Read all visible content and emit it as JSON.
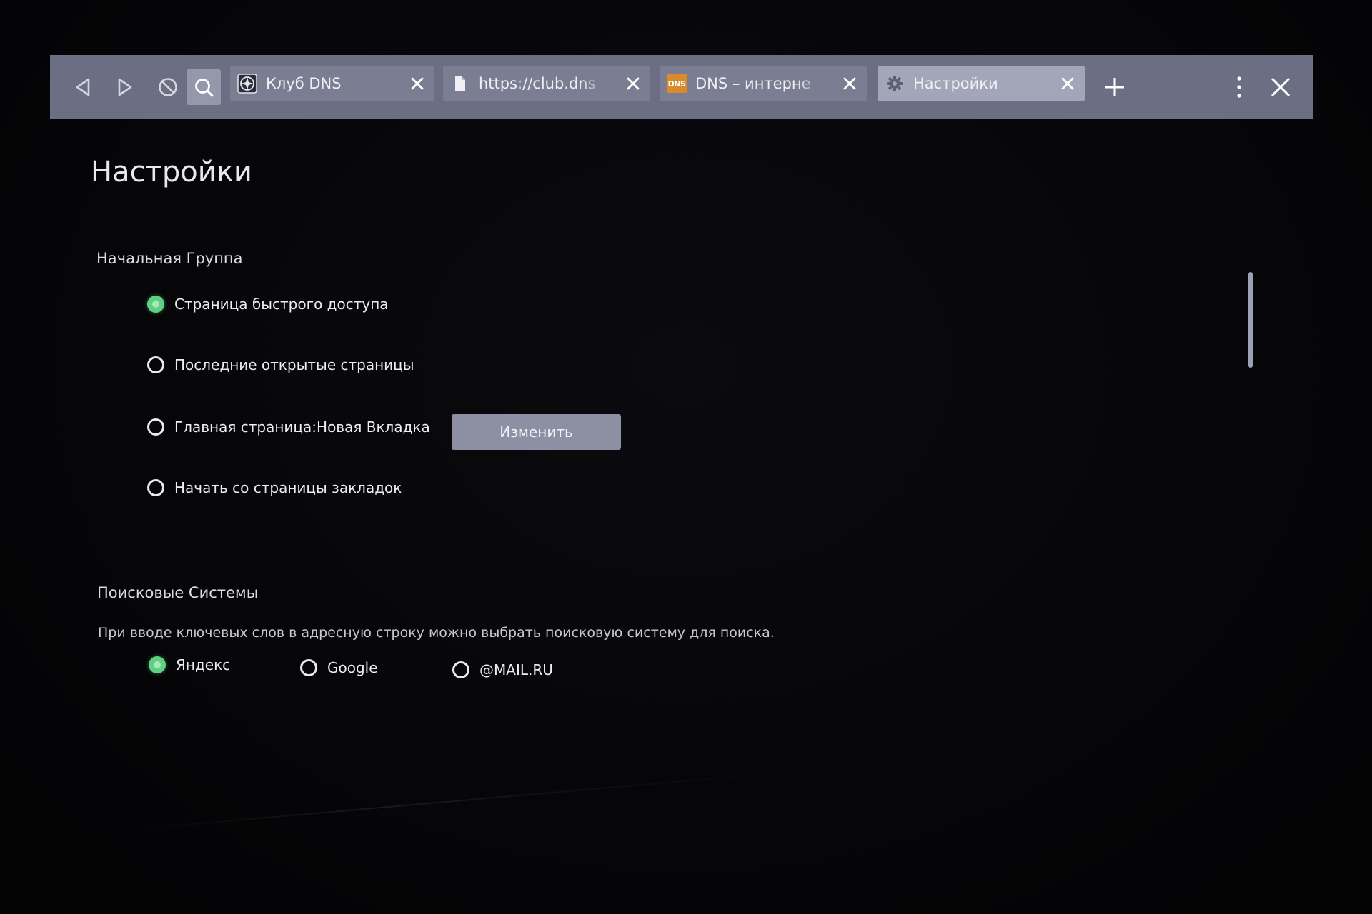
{
  "toolbar": {
    "tabs": [
      {
        "label": "Клуб DNS",
        "icon": "compass-icon",
        "active": false
      },
      {
        "label": "https://club.dns",
        "icon": "document-icon",
        "active": false
      },
      {
        "label": "DNS – интерне",
        "icon": "dns-logo-icon",
        "badge": "DNS",
        "active": false
      },
      {
        "label": "Настройки",
        "icon": "gear-icon",
        "active": true
      }
    ]
  },
  "page": {
    "title": "Настройки"
  },
  "start_group": {
    "title": "Начальная Группа",
    "options": [
      {
        "label": "Страница быстрого доступа",
        "checked": true
      },
      {
        "label": "Последние открытые страницы",
        "checked": false
      },
      {
        "label": "Главная страница:Новая Вкладка",
        "checked": false
      },
      {
        "label": "Начать со страницы закладок",
        "checked": false
      }
    ],
    "change_button": "Изменить"
  },
  "search_engines": {
    "title": "Поисковые Системы",
    "description": "При вводе ключевых слов в адресную строку можно выбрать поисковую систему для поиска.",
    "options": [
      {
        "label": "Яндекс",
        "checked": true
      },
      {
        "label": "Google",
        "checked": false
      },
      {
        "label": "@MAIL.RU",
        "checked": false
      }
    ]
  },
  "colors": {
    "toolbar": "#6c6f83",
    "active_tab": "#a3a6b8",
    "radio_checked": "#5fcf82",
    "background": "#050507"
  }
}
